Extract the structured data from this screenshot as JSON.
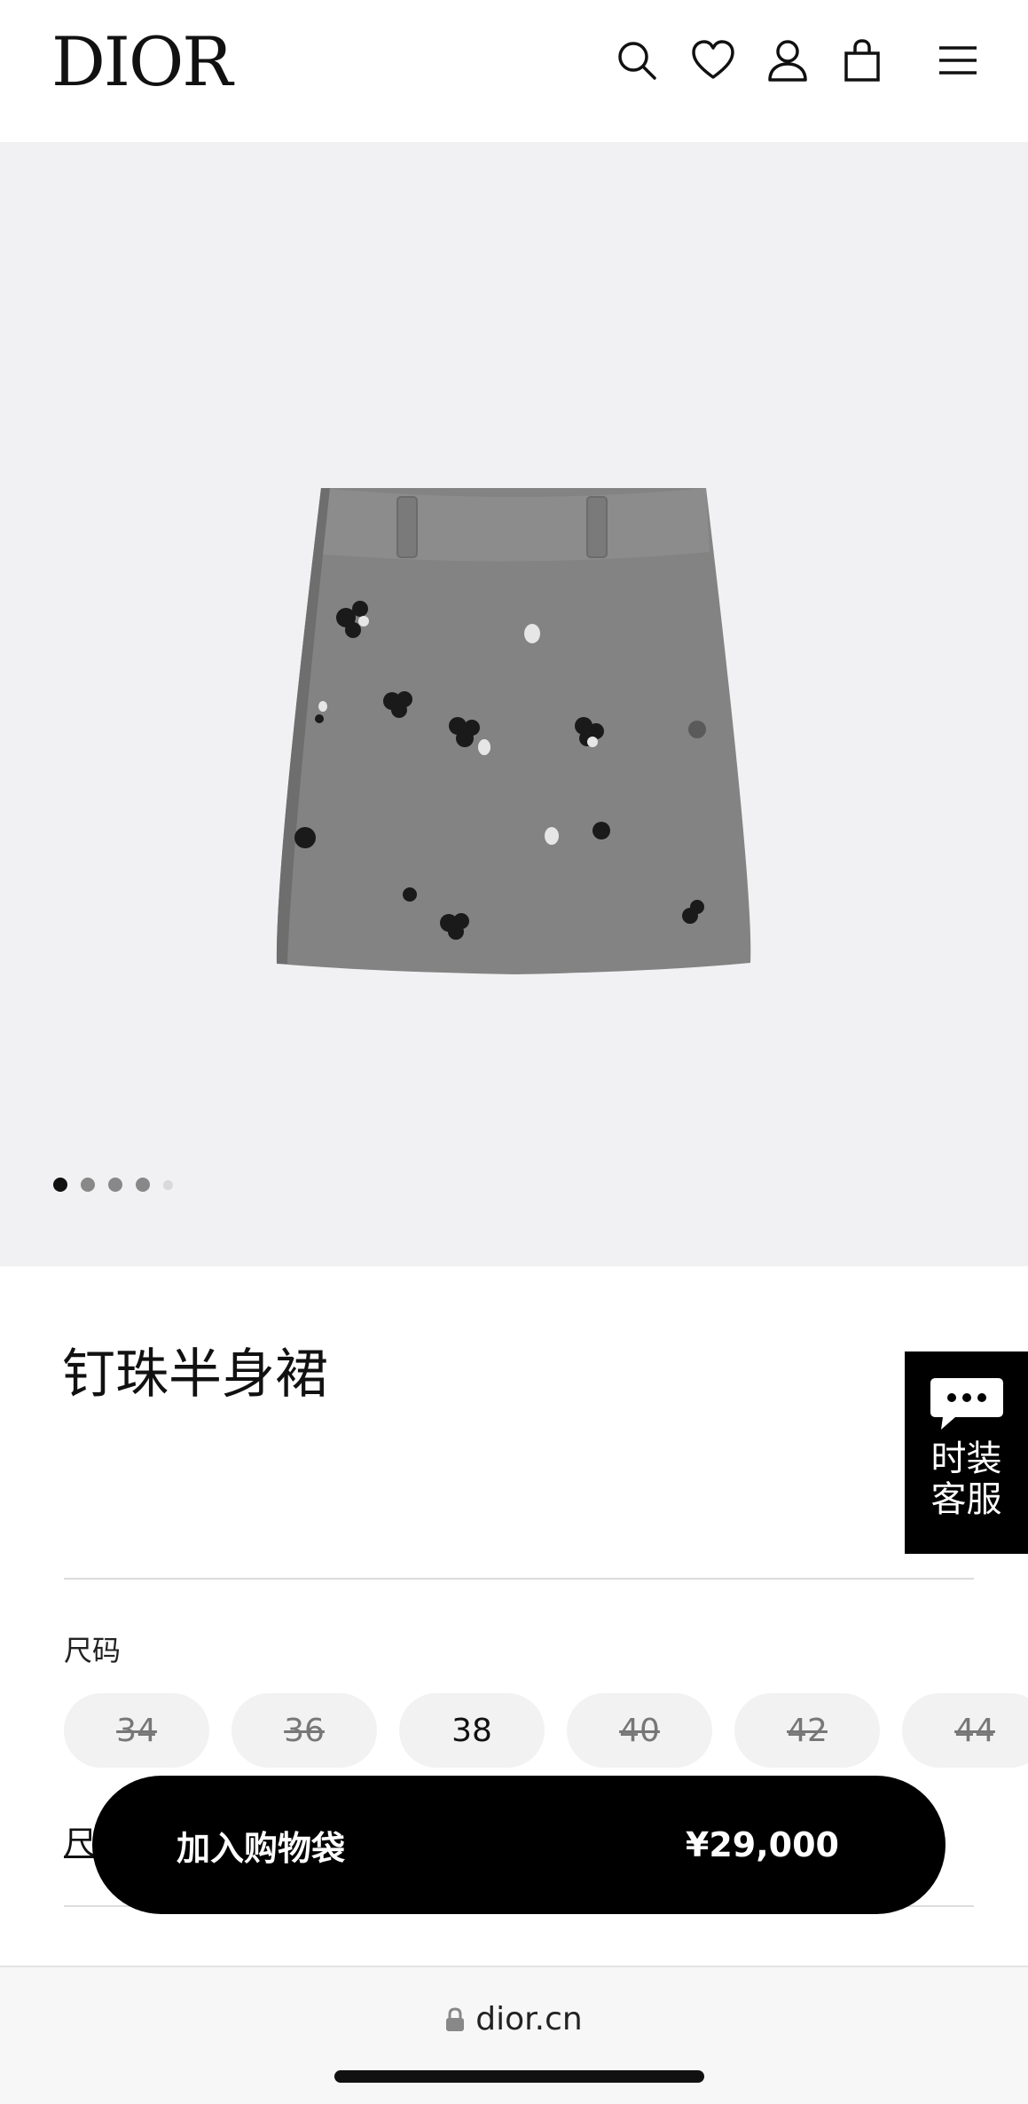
{
  "header": {
    "logo": "DIOR"
  },
  "gallery": {
    "slide_count": 5,
    "active_slide": 1
  },
  "product": {
    "title": "钉珠半身裙"
  },
  "chat": {
    "label_line1": "时装",
    "label_line2": "客服"
  },
  "size": {
    "label": "尺码",
    "options": [
      {
        "value": "34",
        "available": false
      },
      {
        "value": "36",
        "available": false
      },
      {
        "value": "38",
        "available": true
      },
      {
        "value": "40",
        "available": false
      },
      {
        "value": "42",
        "available": false
      },
      {
        "value": "44",
        "available": false
      }
    ],
    "guide_link": "尺"
  },
  "cta": {
    "label": "加入购物袋",
    "price": "¥29,000"
  },
  "browser": {
    "url": "dior.cn"
  },
  "colors": {
    "brand": "#000000",
    "gallery_bg": "#f1f1f3"
  }
}
